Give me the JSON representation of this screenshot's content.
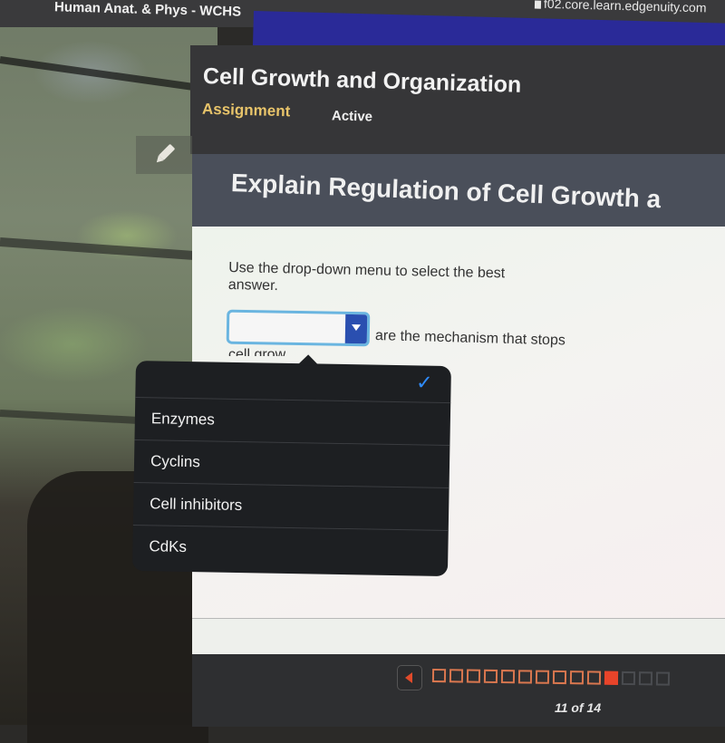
{
  "browser": {
    "course_title": "Human Anat. & Phys - WCHS",
    "url": "f02.core.learn.edgenuity.com"
  },
  "header": {
    "lesson_title": "Cell Growth and Organization",
    "type_label": "Assignment",
    "status_label": "Active"
  },
  "activity": {
    "title": "Explain Regulation of Cell Growth a"
  },
  "question": {
    "instructions": "Use the drop-down menu to select the best answer.",
    "sentence_after": "are the mechanism that stops",
    "sentence_tail": "cell grow",
    "dropdown": {
      "selected": "",
      "options": [
        {
          "label": "",
          "checked": true
        },
        {
          "label": "Enzymes",
          "checked": false
        },
        {
          "label": "Cyclins",
          "checked": false
        },
        {
          "label": "Cell inhibitors",
          "checked": false
        },
        {
          "label": "CdKs",
          "checked": false
        }
      ]
    }
  },
  "footer": {
    "current_page": 11,
    "total_pages": 14,
    "page_label": "11 of 14",
    "visible_pages": 14
  },
  "colors": {
    "accent_blue": "#2a4fb0",
    "check_blue": "#2f8cff",
    "assignment_gold": "#e8c46a",
    "pager_orange": "#e8442a",
    "brand_band": "#2a2a98"
  },
  "icons": {
    "pencil": "pencil-icon",
    "check": "checkmark-icon",
    "dropdown_arrow": "triangle-down-icon",
    "prev": "triangle-left-icon",
    "lock": "lock-icon"
  }
}
